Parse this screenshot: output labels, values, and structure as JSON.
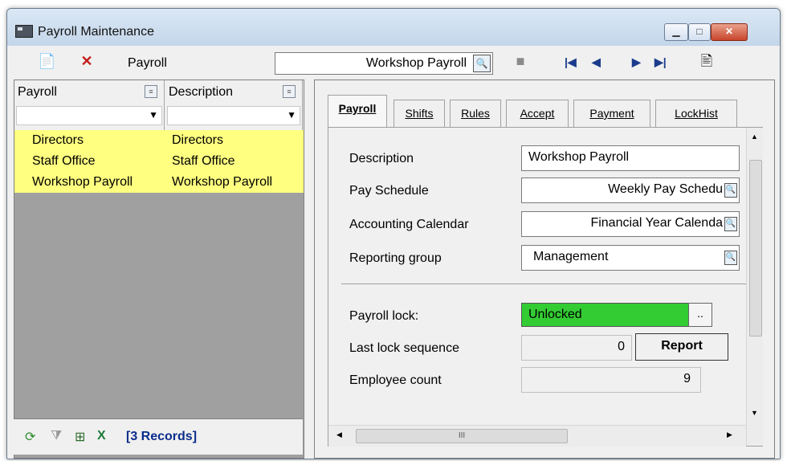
{
  "window": {
    "title": "Payroll Maintenance"
  },
  "toolbar": {
    "label": "Payroll",
    "combo_value": "Workshop Payroll"
  },
  "grid": {
    "columns": [
      "Payroll",
      "Description"
    ],
    "rows": [
      {
        "payroll": "Directors",
        "description": "Directors"
      },
      {
        "payroll": "Staff Office",
        "description": "Staff Office"
      },
      {
        "payroll": "Workshop Payroll",
        "description": "Workshop Payroll"
      }
    ],
    "records_label": "[3 Records]",
    "row_color": "#ffff80"
  },
  "tabs": [
    "Payroll",
    "Shifts",
    "Rules",
    "Accept",
    "Payment",
    "LockHist"
  ],
  "form": {
    "description": {
      "label": "Description",
      "value": "Workshop Payroll"
    },
    "pay_schedule": {
      "label": "Pay Schedule",
      "value": "Weekly Pay Schedu"
    },
    "accounting_calendar": {
      "label": "Accounting Calendar",
      "value": "Financial Year Calenda"
    },
    "reporting_group": {
      "label": "Reporting group",
      "value": "Management"
    },
    "payroll_lock": {
      "label": "Payroll lock:",
      "value": "Unlocked",
      "color": "#33cc33"
    },
    "last_lock_sequence": {
      "label": "Last lock sequence",
      "value": "0"
    },
    "employee_count": {
      "label": "Employee count",
      "value": "9"
    },
    "report_button": "Report",
    "dots_button": ".."
  },
  "scroll": {
    "h_thumb_label": "III"
  }
}
